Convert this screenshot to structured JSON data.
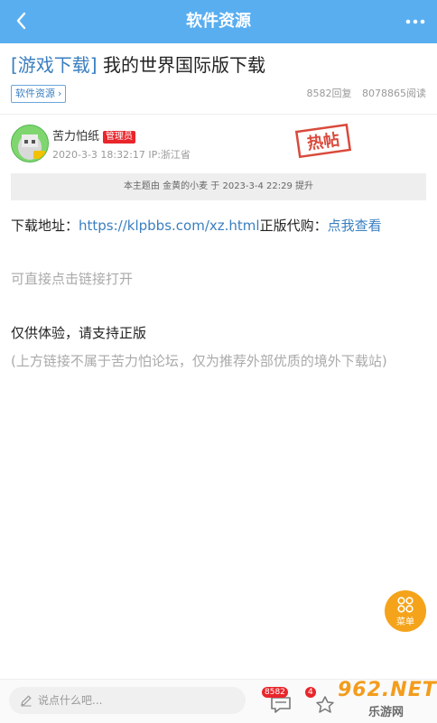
{
  "header": {
    "title": "软件资源"
  },
  "post": {
    "category": "[游戏下载]",
    "title": "我的世界国际版下载",
    "forum_tag": "软件资源",
    "replies": "8582回复",
    "views": "8078865阅读"
  },
  "author": {
    "name": "苦力怕纸",
    "badge": "管理员",
    "datetime": "2020-3-3 18:32:17",
    "ip": "IP:浙江省",
    "stamp": "热帖"
  },
  "notice": "本主题由 金黄的小麦 于 2023-3-4 22:29 提升",
  "content": {
    "download_label": "下载地址：",
    "download_link": "https://klpbbs.com/xz.html",
    "buy_label": "正版代购：",
    "buy_link": "点我查看",
    "hint": "可直接点击链接打开",
    "support": "仅供体验，请支持正版",
    "disclaimer": "(上方链接不属于苦力怕论坛，仅为推荐外部优质的境外下载站)"
  },
  "fab": {
    "label": "菜单"
  },
  "bottom": {
    "comment_placeholder": "说点什么吧...",
    "reply_count": "8582",
    "fav_count": "4"
  },
  "watermark": {
    "brand": "962.NET",
    "sub": "乐游网"
  },
  "colors": {
    "header": "#59aef0",
    "link": "#3a7fc0",
    "badge": "#e8262b",
    "fab": "#f5a31a"
  }
}
